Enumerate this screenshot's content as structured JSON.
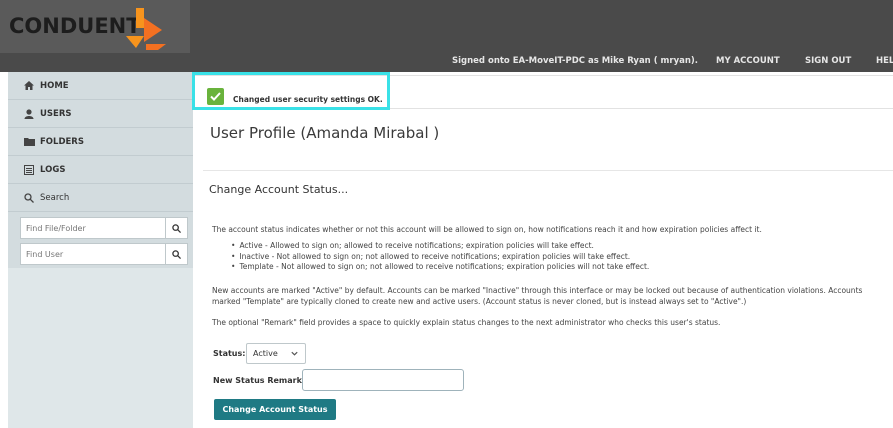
{
  "brand": {
    "name": "CONDUENT",
    "mark_color_1": "#f7941d",
    "mark_color_2": "#f37021"
  },
  "header": {
    "signed_on": "Signed onto EA-MoveIT-PDC as Mike Ryan ( mryan).",
    "nav": [
      "MY ACCOUNT",
      "SIGN OUT",
      "HEL"
    ]
  },
  "sidebar": {
    "items": [
      {
        "label": "HOME",
        "icon": "home-icon"
      },
      {
        "label": "USERS",
        "icon": "user-icon"
      },
      {
        "label": "FOLDERS",
        "icon": "folder-icon"
      },
      {
        "label": "LOGS",
        "icon": "logs-icon"
      }
    ],
    "search_label": "Search",
    "find_file_placeholder": "Find File/Folder",
    "find_user_placeholder": "Find User"
  },
  "alert": {
    "text": "Changed user security settings OK.",
    "color": "#69b33c",
    "highlight_color": "#39e1e7"
  },
  "main": {
    "page_title": "User Profile (Amanda Mirabal )",
    "section_title": "Change Account Status...",
    "intro": "The account status indicates whether or not this account will be allowed to sign on, how notifications reach it and how expiration policies affect it.",
    "bullets": [
      "Active - Allowed to sign on; allowed to receive notifications; expiration policies will take effect.",
      "Inactive - Not allowed to sign on; not allowed to receive notifications; expiration policies will take effect.",
      "Template - Not allowed to sign on; not allowed to receive notifications; expiration policies will not take effect."
    ],
    "para2": "New accounts are marked \"Active\" by default. Accounts can be marked \"Inactive\" through this interface or may be locked out because of authentication violations. Accounts marked \"Template\" are typically cloned to create new and active users. (Account status is never cloned, but is instead always set to \"Active\".)",
    "para3": "The optional \"Remark\" field provides a space to quickly explain status changes to the next administrator who checks this user's status.",
    "status_label": "Status:",
    "status_value": "Active",
    "remark_label": "New Status Remark:",
    "remark_value": "",
    "button_label": "Change Account Status",
    "button_color": "#1f7a84"
  }
}
